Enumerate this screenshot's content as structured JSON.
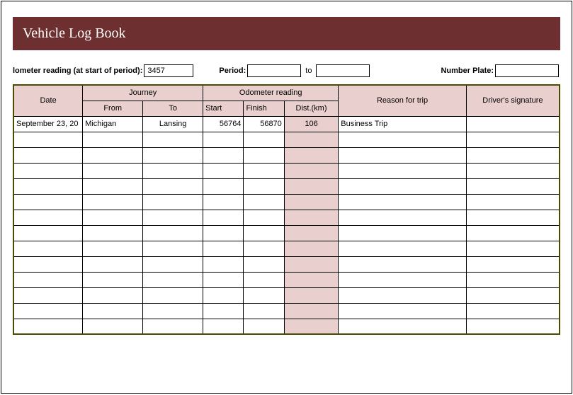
{
  "title": "Vehicle Log Book",
  "meta": {
    "odometer_label": "lometer reading (at start of period):",
    "odometer_value": "3457",
    "period_label": "Period:",
    "period_from": "",
    "period_to_word": "to",
    "period_to": "",
    "plate_label": "Number Plate:",
    "plate_value": ""
  },
  "headers": {
    "date": "Date",
    "journey": "Journey",
    "from": "From",
    "to": "To",
    "odo": "Odometer reading",
    "start": "Start",
    "finish": "Finish",
    "dist": "Dist.(km)",
    "reason": "Reason for trip",
    "sig": "Driver's signature"
  },
  "rows": [
    {
      "date": "September 23, 20",
      "from": "Michigan",
      "to": "Lansing",
      "start": "56764",
      "finish": "56870",
      "dist": "106",
      "reason": "Business Trip",
      "sig": ""
    },
    {
      "date": "",
      "from": "",
      "to": "",
      "start": "",
      "finish": "",
      "dist": "",
      "reason": "",
      "sig": ""
    },
    {
      "date": "",
      "from": "",
      "to": "",
      "start": "",
      "finish": "",
      "dist": "",
      "reason": "",
      "sig": ""
    },
    {
      "date": "",
      "from": "",
      "to": "",
      "start": "",
      "finish": "",
      "dist": "",
      "reason": "",
      "sig": ""
    },
    {
      "date": "",
      "from": "",
      "to": "",
      "start": "",
      "finish": "",
      "dist": "",
      "reason": "",
      "sig": ""
    },
    {
      "date": "",
      "from": "",
      "to": "",
      "start": "",
      "finish": "",
      "dist": "",
      "reason": "",
      "sig": ""
    },
    {
      "date": "",
      "from": "",
      "to": "",
      "start": "",
      "finish": "",
      "dist": "",
      "reason": "",
      "sig": ""
    },
    {
      "date": "",
      "from": "",
      "to": "",
      "start": "",
      "finish": "",
      "dist": "",
      "reason": "",
      "sig": ""
    },
    {
      "date": "",
      "from": "",
      "to": "",
      "start": "",
      "finish": "",
      "dist": "",
      "reason": "",
      "sig": ""
    },
    {
      "date": "",
      "from": "",
      "to": "",
      "start": "",
      "finish": "",
      "dist": "",
      "reason": "",
      "sig": ""
    },
    {
      "date": "",
      "from": "",
      "to": "",
      "start": "",
      "finish": "",
      "dist": "",
      "reason": "",
      "sig": ""
    },
    {
      "date": "",
      "from": "",
      "to": "",
      "start": "",
      "finish": "",
      "dist": "",
      "reason": "",
      "sig": ""
    },
    {
      "date": "",
      "from": "",
      "to": "",
      "start": "",
      "finish": "",
      "dist": "",
      "reason": "",
      "sig": ""
    },
    {
      "date": "",
      "from": "",
      "to": "",
      "start": "",
      "finish": "",
      "dist": "",
      "reason": "",
      "sig": ""
    }
  ]
}
